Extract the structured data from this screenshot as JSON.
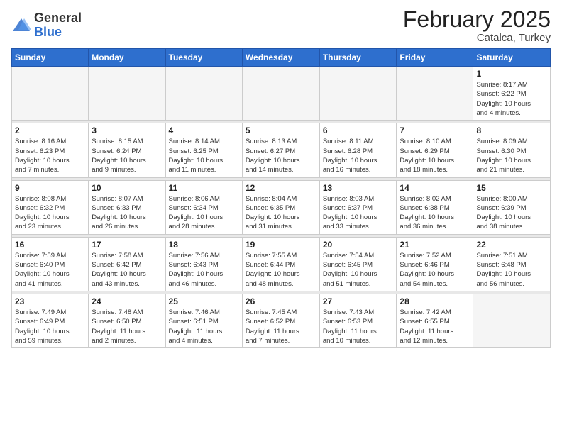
{
  "header": {
    "logo_general": "General",
    "logo_blue": "Blue",
    "title": "February 2025",
    "location": "Catalca, Turkey"
  },
  "weekdays": [
    "Sunday",
    "Monday",
    "Tuesday",
    "Wednesday",
    "Thursday",
    "Friday",
    "Saturday"
  ],
  "weeks": [
    [
      {
        "day": "",
        "info": ""
      },
      {
        "day": "",
        "info": ""
      },
      {
        "day": "",
        "info": ""
      },
      {
        "day": "",
        "info": ""
      },
      {
        "day": "",
        "info": ""
      },
      {
        "day": "",
        "info": ""
      },
      {
        "day": "1",
        "info": "Sunrise: 8:17 AM\nSunset: 6:22 PM\nDaylight: 10 hours\nand 4 minutes."
      }
    ],
    [
      {
        "day": "2",
        "info": "Sunrise: 8:16 AM\nSunset: 6:23 PM\nDaylight: 10 hours\nand 7 minutes."
      },
      {
        "day": "3",
        "info": "Sunrise: 8:15 AM\nSunset: 6:24 PM\nDaylight: 10 hours\nand 9 minutes."
      },
      {
        "day": "4",
        "info": "Sunrise: 8:14 AM\nSunset: 6:25 PM\nDaylight: 10 hours\nand 11 minutes."
      },
      {
        "day": "5",
        "info": "Sunrise: 8:13 AM\nSunset: 6:27 PM\nDaylight: 10 hours\nand 14 minutes."
      },
      {
        "day": "6",
        "info": "Sunrise: 8:11 AM\nSunset: 6:28 PM\nDaylight: 10 hours\nand 16 minutes."
      },
      {
        "day": "7",
        "info": "Sunrise: 8:10 AM\nSunset: 6:29 PM\nDaylight: 10 hours\nand 18 minutes."
      },
      {
        "day": "8",
        "info": "Sunrise: 8:09 AM\nSunset: 6:30 PM\nDaylight: 10 hours\nand 21 minutes."
      }
    ],
    [
      {
        "day": "9",
        "info": "Sunrise: 8:08 AM\nSunset: 6:32 PM\nDaylight: 10 hours\nand 23 minutes."
      },
      {
        "day": "10",
        "info": "Sunrise: 8:07 AM\nSunset: 6:33 PM\nDaylight: 10 hours\nand 26 minutes."
      },
      {
        "day": "11",
        "info": "Sunrise: 8:06 AM\nSunset: 6:34 PM\nDaylight: 10 hours\nand 28 minutes."
      },
      {
        "day": "12",
        "info": "Sunrise: 8:04 AM\nSunset: 6:35 PM\nDaylight: 10 hours\nand 31 minutes."
      },
      {
        "day": "13",
        "info": "Sunrise: 8:03 AM\nSunset: 6:37 PM\nDaylight: 10 hours\nand 33 minutes."
      },
      {
        "day": "14",
        "info": "Sunrise: 8:02 AM\nSunset: 6:38 PM\nDaylight: 10 hours\nand 36 minutes."
      },
      {
        "day": "15",
        "info": "Sunrise: 8:00 AM\nSunset: 6:39 PM\nDaylight: 10 hours\nand 38 minutes."
      }
    ],
    [
      {
        "day": "16",
        "info": "Sunrise: 7:59 AM\nSunset: 6:40 PM\nDaylight: 10 hours\nand 41 minutes."
      },
      {
        "day": "17",
        "info": "Sunrise: 7:58 AM\nSunset: 6:42 PM\nDaylight: 10 hours\nand 43 minutes."
      },
      {
        "day": "18",
        "info": "Sunrise: 7:56 AM\nSunset: 6:43 PM\nDaylight: 10 hours\nand 46 minutes."
      },
      {
        "day": "19",
        "info": "Sunrise: 7:55 AM\nSunset: 6:44 PM\nDaylight: 10 hours\nand 48 minutes."
      },
      {
        "day": "20",
        "info": "Sunrise: 7:54 AM\nSunset: 6:45 PM\nDaylight: 10 hours\nand 51 minutes."
      },
      {
        "day": "21",
        "info": "Sunrise: 7:52 AM\nSunset: 6:46 PM\nDaylight: 10 hours\nand 54 minutes."
      },
      {
        "day": "22",
        "info": "Sunrise: 7:51 AM\nSunset: 6:48 PM\nDaylight: 10 hours\nand 56 minutes."
      }
    ],
    [
      {
        "day": "23",
        "info": "Sunrise: 7:49 AM\nSunset: 6:49 PM\nDaylight: 10 hours\nand 59 minutes."
      },
      {
        "day": "24",
        "info": "Sunrise: 7:48 AM\nSunset: 6:50 PM\nDaylight: 11 hours\nand 2 minutes."
      },
      {
        "day": "25",
        "info": "Sunrise: 7:46 AM\nSunset: 6:51 PM\nDaylight: 11 hours\nand 4 minutes."
      },
      {
        "day": "26",
        "info": "Sunrise: 7:45 AM\nSunset: 6:52 PM\nDaylight: 11 hours\nand 7 minutes."
      },
      {
        "day": "27",
        "info": "Sunrise: 7:43 AM\nSunset: 6:53 PM\nDaylight: 11 hours\nand 10 minutes."
      },
      {
        "day": "28",
        "info": "Sunrise: 7:42 AM\nSunset: 6:55 PM\nDaylight: 11 hours\nand 12 minutes."
      },
      {
        "day": "",
        "info": ""
      }
    ]
  ]
}
